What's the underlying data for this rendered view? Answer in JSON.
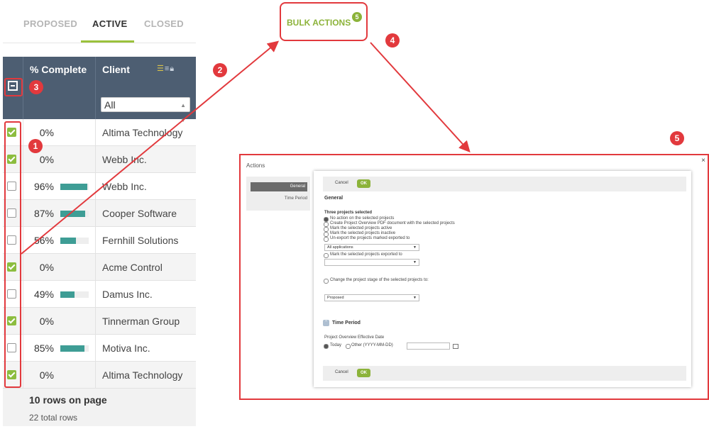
{
  "tabs": [
    {
      "label": "PROPOSED",
      "active": false
    },
    {
      "label": "ACTIVE",
      "active": true
    },
    {
      "label": "CLOSED",
      "active": false
    }
  ],
  "grid": {
    "header": {
      "complete": "% Complete",
      "client": "Client",
      "filter_value": "All"
    },
    "rows": [
      {
        "checked": true,
        "pct": "0%",
        "progress": 0,
        "client": "Altima Technology"
      },
      {
        "checked": true,
        "pct": "0%",
        "progress": 0,
        "client": "Webb Inc."
      },
      {
        "checked": false,
        "pct": "96%",
        "progress": 0.96,
        "client": "Webb Inc."
      },
      {
        "checked": false,
        "pct": "87%",
        "progress": 0.87,
        "client": "Cooper Software"
      },
      {
        "checked": false,
        "pct": "56%",
        "progress": 0.56,
        "client": "Fernhill Solutions"
      },
      {
        "checked": true,
        "pct": "0%",
        "progress": 0,
        "client": "Acme Control"
      },
      {
        "checked": false,
        "pct": "49%",
        "progress": 0.49,
        "client": "Damus Inc."
      },
      {
        "checked": true,
        "pct": "0%",
        "progress": 0,
        "client": "Tinnerman Group"
      },
      {
        "checked": false,
        "pct": "85%",
        "progress": 0.85,
        "client": "Motiva Inc."
      },
      {
        "checked": true,
        "pct": "0%",
        "progress": 0,
        "client": "Altima Technology"
      }
    ],
    "footer": {
      "rows_on_page": "10 rows on page",
      "total_rows": "22 total rows"
    }
  },
  "bulk_actions": {
    "label": "BULK ACTIONS",
    "badge": "5"
  },
  "markers": [
    "1",
    "2",
    "3",
    "4",
    "5"
  ],
  "panel": {
    "title": "Actions",
    "close": "×",
    "side_general": "General",
    "side_time": "Time Period",
    "cancel": "Cancel",
    "ok": "OK",
    "general_heading": "General",
    "selected_heading": "Three projects selected",
    "options": [
      "No action on the selected projects",
      "Create Project Overview PDF document with the selected projects",
      "Mark the selected projects active",
      "Mark the selected projects inactive",
      "Un-export the projects marked exported to"
    ],
    "select_applications": "All applications",
    "mark_exported": "Mark the selected projects exported to",
    "change_stage": "Change the project stage of the selected projects to:",
    "stage_value": "Proposed",
    "time_period_heading": "Time Period",
    "effective_date_label": "Project Overview Effective Date",
    "today": "Today",
    "other": "Other (YYYY-MM-DD)"
  },
  "colors": {
    "accent_green": "#8cb33a",
    "header_blue": "#4d5e72",
    "bar_teal": "#3e9d95",
    "annotation_red": "#e2393d"
  }
}
